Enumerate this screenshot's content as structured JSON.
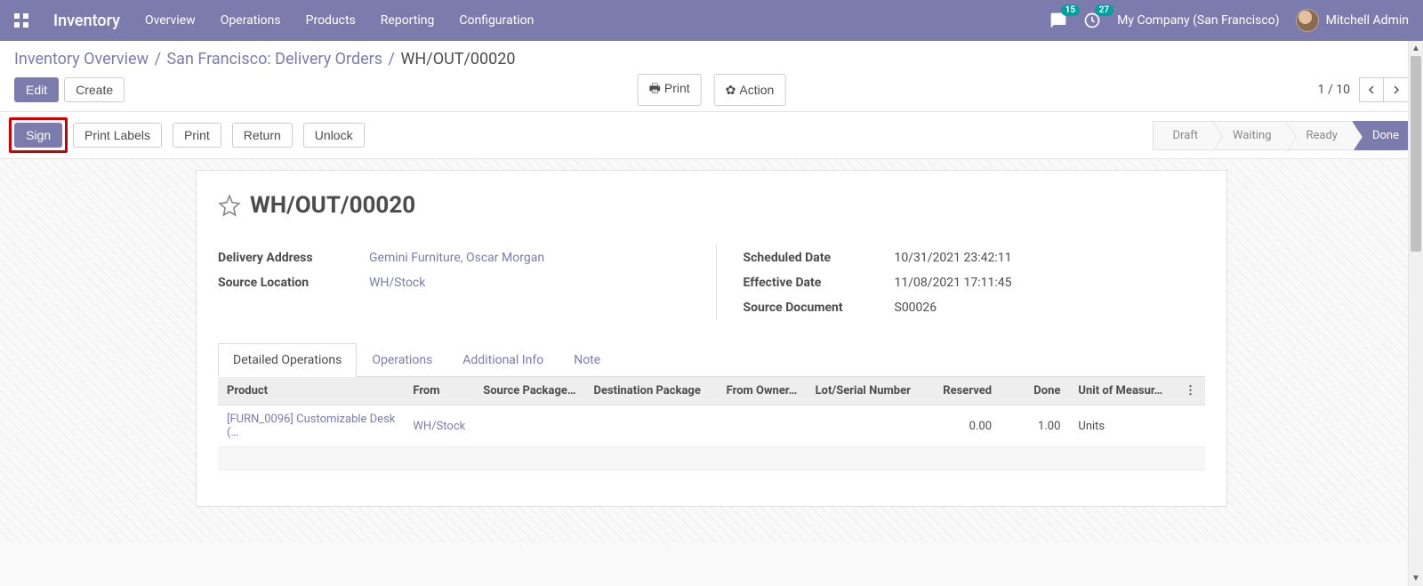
{
  "navbar": {
    "app_name": "Inventory",
    "menus": [
      "Overview",
      "Operations",
      "Products",
      "Reporting",
      "Configuration"
    ],
    "msg_badge": "15",
    "activity_badge": "27",
    "company": "My Company (San Francisco)",
    "user": "Mitchell Admin"
  },
  "breadcrumb": {
    "items": [
      "Inventory Overview",
      "San Francisco: Delivery Orders"
    ],
    "current": "WH/OUT/00020"
  },
  "controls": {
    "edit": "Edit",
    "create": "Create",
    "print": "Print",
    "action": "Action",
    "pager": "1 / 10"
  },
  "actionbar": {
    "sign": "Sign",
    "print_labels": "Print Labels",
    "print": "Print",
    "return": "Return",
    "unlock": "Unlock",
    "steps": [
      "Draft",
      "Waiting",
      "Ready",
      "Done"
    ],
    "active_step": "Done"
  },
  "record": {
    "title": "WH/OUT/00020",
    "delivery_address_label": "Delivery Address",
    "delivery_address": "Gemini Furniture, Oscar Morgan",
    "source_location_label": "Source Location",
    "source_location": "WH/Stock",
    "scheduled_date_label": "Scheduled Date",
    "scheduled_date": "10/31/2021 23:42:11",
    "effective_date_label": "Effective Date",
    "effective_date": "11/08/2021 17:11:45",
    "source_document_label": "Source Document",
    "source_document": "S00026"
  },
  "tabs": [
    "Detailed Operations",
    "Operations",
    "Additional Info",
    "Note"
  ],
  "table": {
    "headers": {
      "product": "Product",
      "from": "From",
      "source_package": "Source Package…",
      "dest_package": "Destination Package",
      "from_owner": "From Owner…",
      "lot": "Lot/Serial Number",
      "reserved": "Reserved",
      "done": "Done",
      "uom": "Unit of Measur…"
    },
    "rows": [
      {
        "product": "[FURN_0096] Customizable Desk (…",
        "from": "WH/Stock",
        "source_package": "",
        "dest_package": "",
        "from_owner": "",
        "lot": "",
        "reserved": "0.00",
        "done": "1.00",
        "uom": "Units"
      }
    ]
  }
}
